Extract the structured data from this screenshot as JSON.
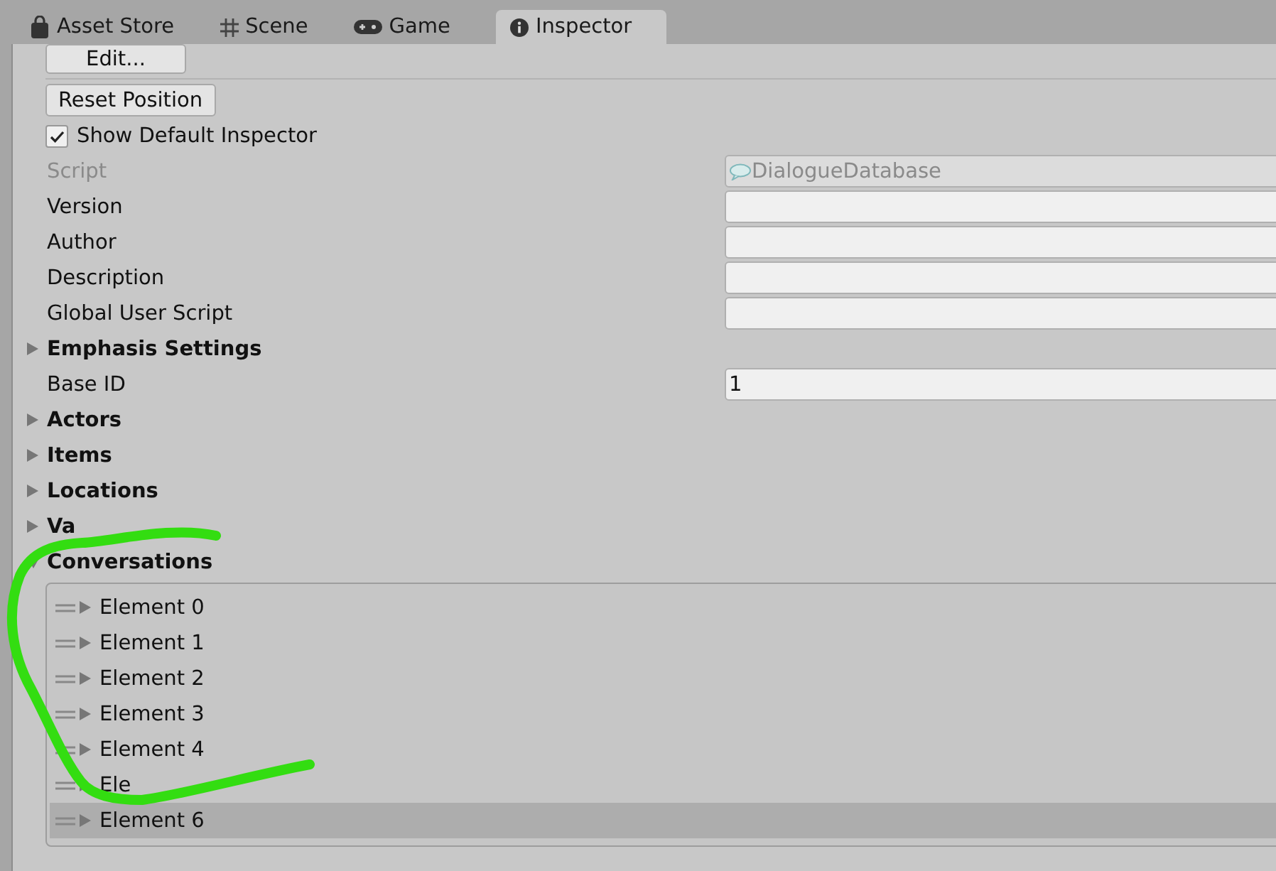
{
  "tabs": [
    {
      "label": "Asset Store",
      "kind": "store",
      "selected": false
    },
    {
      "label": "Scene",
      "kind": "scene",
      "selected": false
    },
    {
      "label": "Game",
      "kind": "game",
      "selected": false
    },
    {
      "label": "Inspector",
      "kind": "inspector",
      "selected": true
    }
  ],
  "edit_button": "Edit...",
  "reset_button": "Reset Position",
  "show_default_inspector": {
    "label": "Show Default Inspector",
    "checked": true
  },
  "properties": [
    {
      "kind": "field",
      "label": "Script",
      "value": "DialogueDatabase",
      "disabled": true
    },
    {
      "kind": "field",
      "label": "Version",
      "disabled": false
    },
    {
      "kind": "field",
      "label": "Author",
      "disabled": false
    },
    {
      "kind": "field",
      "label": "Description",
      "disabled": false
    },
    {
      "kind": "field",
      "label": "Global User Script",
      "disabled": false
    },
    {
      "kind": "foldout",
      "label": "Emphasis Settings",
      "expanded": false
    },
    {
      "kind": "field",
      "label": "Base ID",
      "value": "1",
      "disabled": false
    },
    {
      "kind": "foldout",
      "label": "Actors",
      "expanded": false
    },
    {
      "kind": "foldout",
      "label": "Items",
      "expanded": false
    },
    {
      "kind": "foldout",
      "label": "Locations",
      "expanded": false
    },
    {
      "kind": "foldout",
      "label": "Va",
      "expanded": false
    },
    {
      "kind": "foldout",
      "label": "Conversations",
      "expanded": true,
      "children": [
        {
          "label": "Element 0",
          "selected": false
        },
        {
          "label": "Element 1",
          "selected": false
        },
        {
          "label": "Element 2",
          "selected": false
        },
        {
          "label": "Element 3",
          "selected": false
        },
        {
          "label": "Element 4",
          "selected": false
        },
        {
          "label": "Ele",
          "selected": false
        },
        {
          "label": "Element 6",
          "selected": true
        }
      ]
    }
  ]
}
